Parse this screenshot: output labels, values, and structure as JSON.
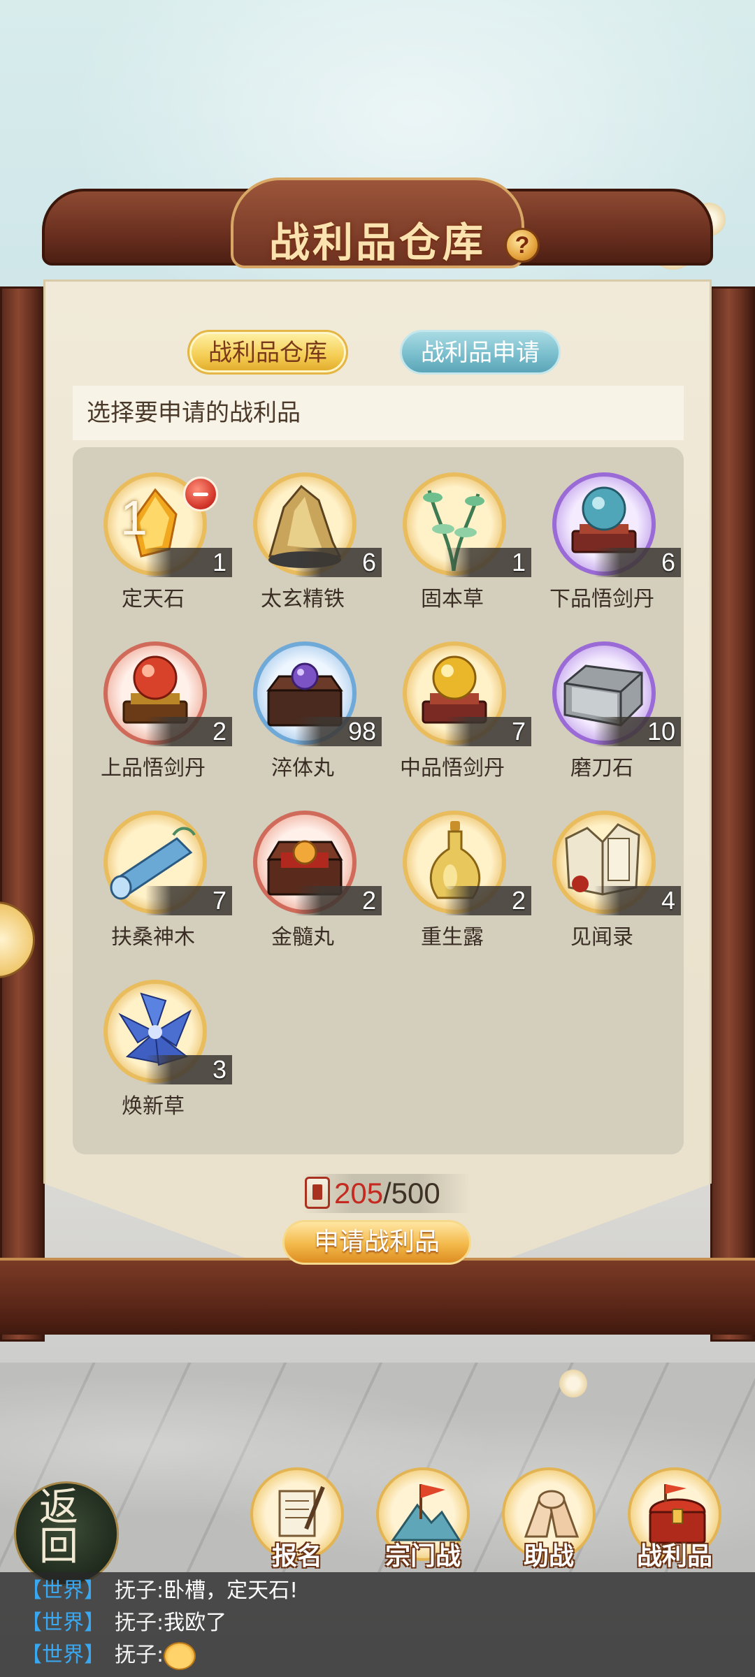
{
  "header": {
    "title": "战利品仓库",
    "help": "?"
  },
  "tabs": [
    {
      "label": "战利品仓库",
      "active": true
    },
    {
      "label": "战利品申请",
      "active": false
    }
  ],
  "hint": "选择要申请的战利品",
  "items": [
    {
      "name": "定天石",
      "count": "1",
      "selected": "1",
      "icon": "yellow-crystal-icon"
    },
    {
      "name": "太玄精铁",
      "count": "6",
      "icon": "gold-ore-icon"
    },
    {
      "name": "固本草",
      "count": "1",
      "icon": "green-herb-icon"
    },
    {
      "name": "下品悟剑丹",
      "count": "6",
      "icon": "blue-pill-icon"
    },
    {
      "name": "上品悟剑丹",
      "count": "2",
      "icon": "red-pill-icon"
    },
    {
      "name": "淬体丸",
      "count": "98",
      "icon": "purple-orb-chest-icon"
    },
    {
      "name": "中品悟剑丹",
      "count": "7",
      "icon": "gold-pill-icon"
    },
    {
      "name": "磨刀石",
      "count": "10",
      "icon": "whetstone-icon"
    },
    {
      "name": "扶桑神木",
      "count": "7",
      "icon": "blue-wood-icon"
    },
    {
      "name": "金髓丸",
      "count": "2",
      "icon": "gold-orb-chest-icon"
    },
    {
      "name": "重生露",
      "count": "2",
      "icon": "gourd-bottle-icon"
    },
    {
      "name": "见闻录",
      "count": "4",
      "icon": "book-icon"
    },
    {
      "name": "焕新草",
      "count": "3",
      "icon": "blue-flower-icon"
    }
  ],
  "quota": {
    "used": "205",
    "total": "/500"
  },
  "apply_button": "申请战利品",
  "back": {
    "line1": "返",
    "line2": "回"
  },
  "nav": [
    {
      "label": "报名",
      "icon": "scroll-brush-icon"
    },
    {
      "label": "宗门战",
      "icon": "flag-mountain-icon"
    },
    {
      "label": "助战",
      "icon": "handshake-icon"
    },
    {
      "label": "战利品",
      "icon": "treasure-chest-icon"
    }
  ],
  "chat": [
    {
      "channel": "【世界】",
      "user": "抚子:",
      "msg": "卧槽，定天石!"
    },
    {
      "channel": "【世界】",
      "user": "抚子:",
      "msg": "我欧了"
    },
    {
      "channel": "【世界】",
      "user": "抚子:",
      "msg": "",
      "emoji": "bear-face-icon"
    }
  ],
  "colors": {
    "quota_used": "#c42a1f",
    "tab_active": "#f4cd53",
    "tab_inactive": "#77bccb",
    "chat_channel": "#3aa8f0"
  }
}
